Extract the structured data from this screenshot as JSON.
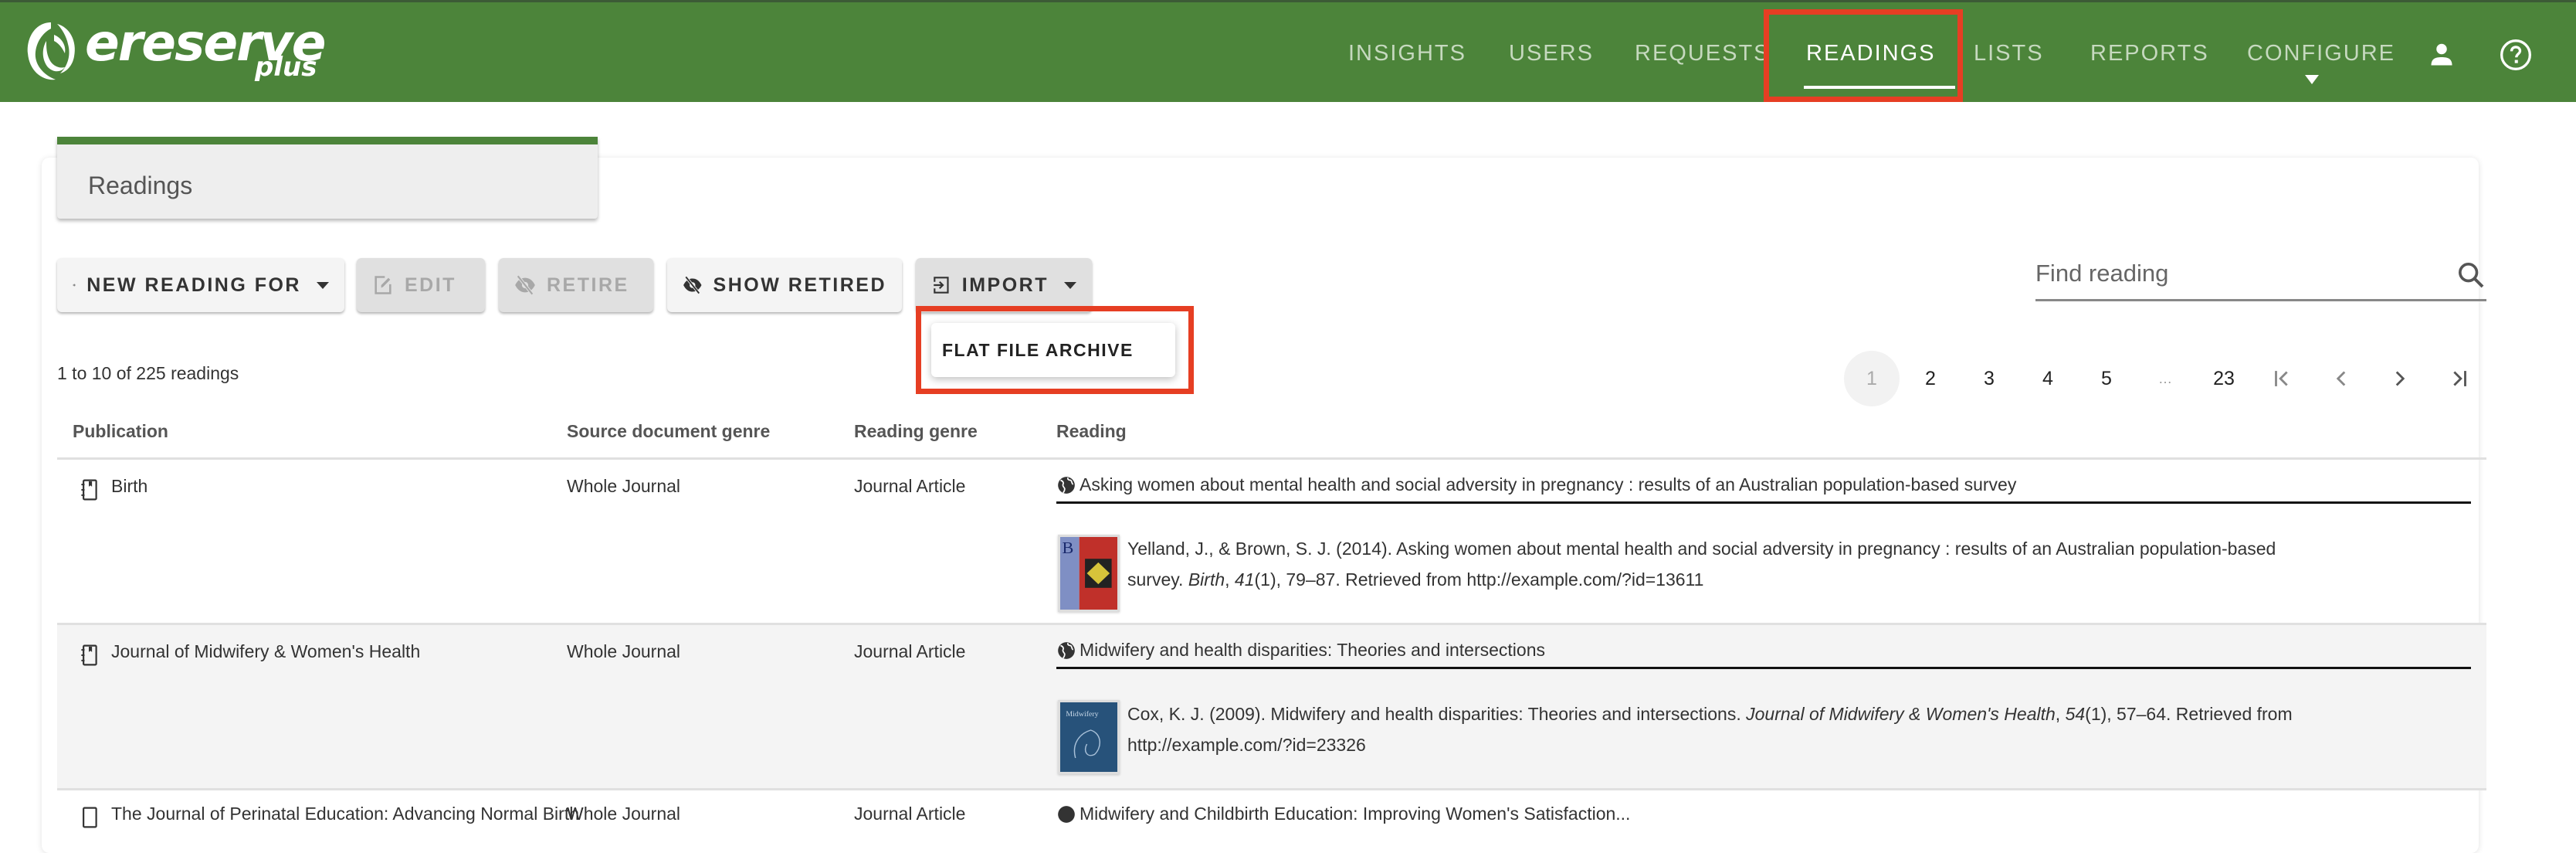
{
  "app": {
    "logo_text": "ereserve",
    "logo_sub": "plus",
    "brand_color": "#4c843a",
    "highlight_color": "#e63e23"
  },
  "nav": {
    "items": [
      {
        "label": "INSIGHTS",
        "active": false
      },
      {
        "label": "USERS",
        "active": false
      },
      {
        "label": "REQUESTS",
        "active": false
      },
      {
        "label": "READINGS",
        "active": true
      },
      {
        "label": "LISTS",
        "active": false
      },
      {
        "label": "REPORTS",
        "active": false
      },
      {
        "label": "CONFIGURE",
        "active": false
      }
    ],
    "account_icon": "account-icon",
    "help_icon": "help-icon"
  },
  "page": {
    "title": "Readings"
  },
  "toolbar": {
    "new_reading_for": "NEW READING FOR",
    "edit": "EDIT",
    "retire": "RETIRE",
    "show_retired": "SHOW RETIRED",
    "import": "IMPORT"
  },
  "import_menu": {
    "items": [
      "FLAT FILE ARCHIVE"
    ]
  },
  "search": {
    "placeholder": "Find reading",
    "value": ""
  },
  "results": {
    "summary": "1 to 10 of 225 readings"
  },
  "pagination": {
    "current": "1",
    "pages": [
      "1",
      "2",
      "3",
      "4",
      "5",
      "…",
      "23"
    ],
    "first_icon": "first-page-icon",
    "prev_icon": "chevron-left-icon",
    "next_icon": "chevron-right-icon",
    "last_icon": "last-page-icon"
  },
  "table": {
    "headers": [
      "Publication",
      "Source document genre",
      "Reading genre",
      "Reading"
    ],
    "rows": [
      {
        "publication": "Birth",
        "source_genre": "Whole Journal",
        "reading_genre": "Journal Article",
        "reading_title": "Asking women about mental health and social adversity in pregnancy : results of an Australian population-based survey",
        "citation_pre": "Yelland, J., & Brown, S. J. (2014). Asking women about mental health and social adversity in pregnancy : results of an Australian population-based survey. ",
        "citation_journal": "Birth",
        "citation_sep": ", ",
        "citation_volume": "41",
        "citation_post": "(1), 79–87. Retrieved from http://example.com/?id=13611"
      },
      {
        "publication": "Journal of Midwifery & Women's Health",
        "source_genre": "Whole Journal",
        "reading_genre": "Journal Article",
        "reading_title": "Midwifery and health disparities: Theories and intersections",
        "citation_pre": "Cox, K. J. (2009). Midwifery and health disparities: Theories and intersections. ",
        "citation_journal": "Journal of Midwifery & Women's Health",
        "citation_sep": ", ",
        "citation_volume": "54",
        "citation_post": "(1), 57–64. Retrieved from http://example.com/?id=23326"
      },
      {
        "publication": "The Journal of Perinatal Education: Advancing Normal Birth",
        "source_genre": "Whole Journal",
        "reading_genre": "Journal Article",
        "reading_title": "Midwifery and Childbirth Education: Improving Women's Satisfaction..."
      }
    ]
  }
}
